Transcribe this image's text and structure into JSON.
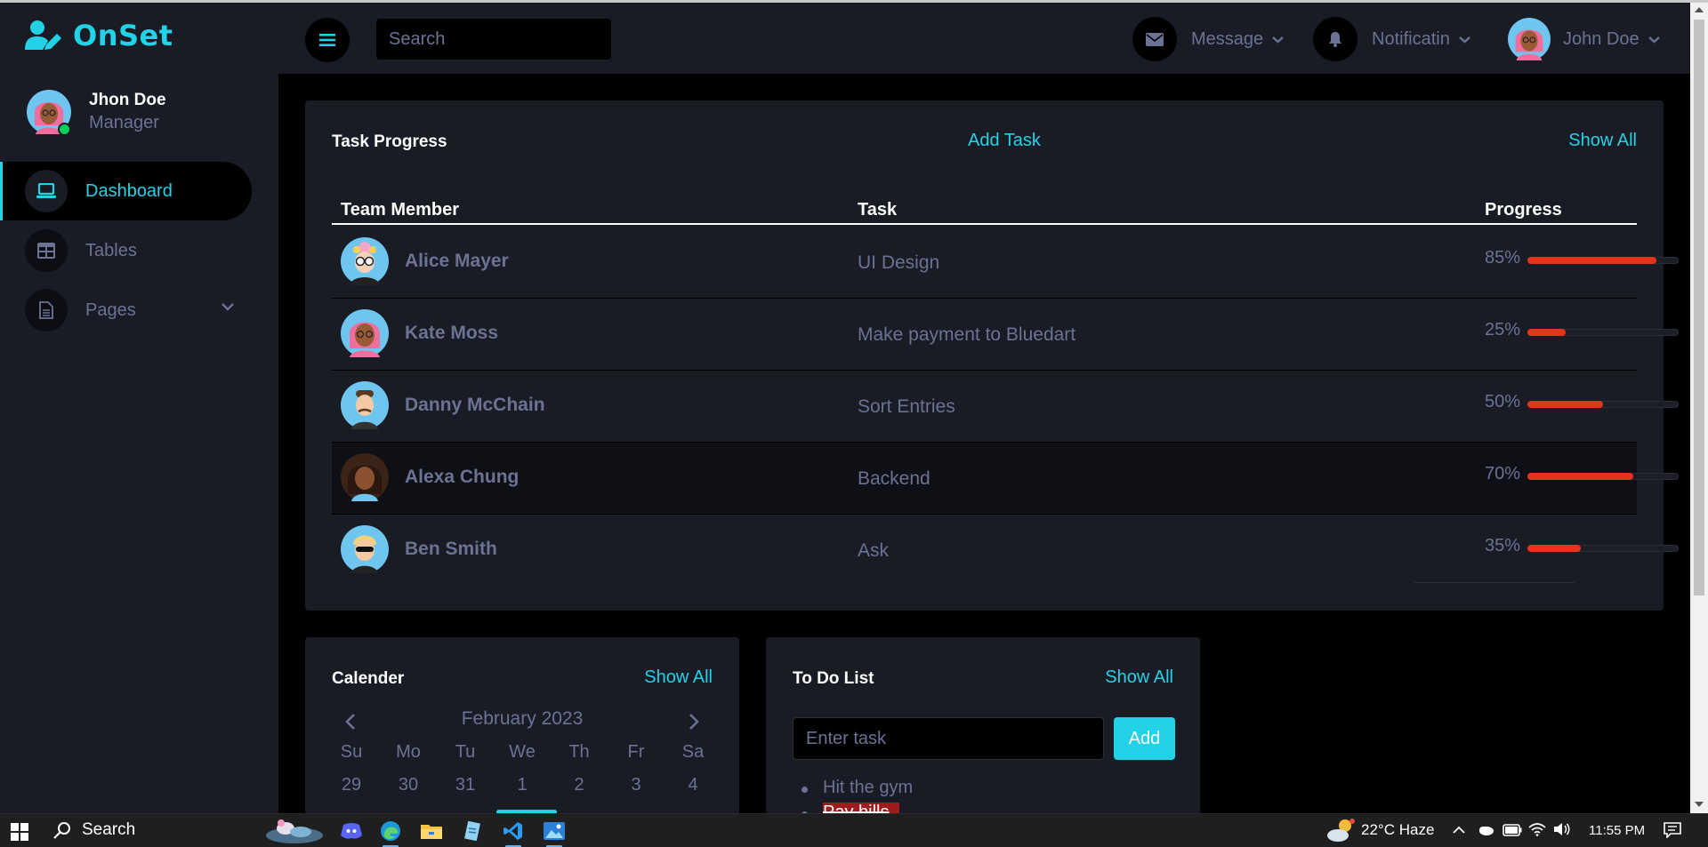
{
  "brand": {
    "name": "OnSet",
    "accent": "#22d3e8"
  },
  "sidebar": {
    "user": {
      "name": "Jhon Doe",
      "role": "Manager"
    },
    "items": [
      {
        "label": "Dashboard",
        "icon": "laptop-icon",
        "active": true
      },
      {
        "label": "Tables",
        "icon": "table-icon",
        "active": false
      },
      {
        "label": "Pages",
        "icon": "file-icon",
        "active": false,
        "has_submenu": true
      }
    ]
  },
  "topbar": {
    "search_placeholder": "Search",
    "message_label": "Message",
    "notification_label": "Notificatin",
    "user_name": "John Doe"
  },
  "task_progress": {
    "title": "Task Progress",
    "add_label": "Add Task",
    "show_all": "Show All",
    "columns": [
      "Team Member",
      "Task",
      "Progress"
    ],
    "rows": [
      {
        "member": "Alice Mayer",
        "task": "UI Design",
        "progress": 85,
        "progress_label": "85%"
      },
      {
        "member": "Kate Moss",
        "task": "Make payment to Bluedart",
        "progress": 25,
        "progress_label": "25%"
      },
      {
        "member": "Danny McChain",
        "task": "Sort Entries",
        "progress": 50,
        "progress_label": "50%"
      },
      {
        "member": "Alexa Chung",
        "task": "Backend",
        "progress": 70,
        "progress_label": "70%"
      },
      {
        "member": "Ben Smith",
        "task": "Ask",
        "progress": 35,
        "progress_label": "35%"
      }
    ],
    "bar_color": "#e4341b"
  },
  "calendar": {
    "title": "Calender",
    "show_all": "Show All",
    "month": "February 2023",
    "weekdays": [
      "Su",
      "Mo",
      "Tu",
      "We",
      "Th",
      "Fr",
      "Sa"
    ],
    "first_week": [
      "29",
      "30",
      "31",
      "1",
      "2",
      "3",
      "4"
    ]
  },
  "todo": {
    "title": "To Do List",
    "show_all": "Show All",
    "input_placeholder": "Enter task",
    "add_label": "Add",
    "items": [
      {
        "text": "Hit the gym",
        "done": false
      },
      {
        "text": "Pay bills",
        "done": true
      }
    ]
  },
  "taskbar": {
    "search_label": "Search",
    "weather": "22°C  Haze",
    "time": "11:55 PM"
  }
}
